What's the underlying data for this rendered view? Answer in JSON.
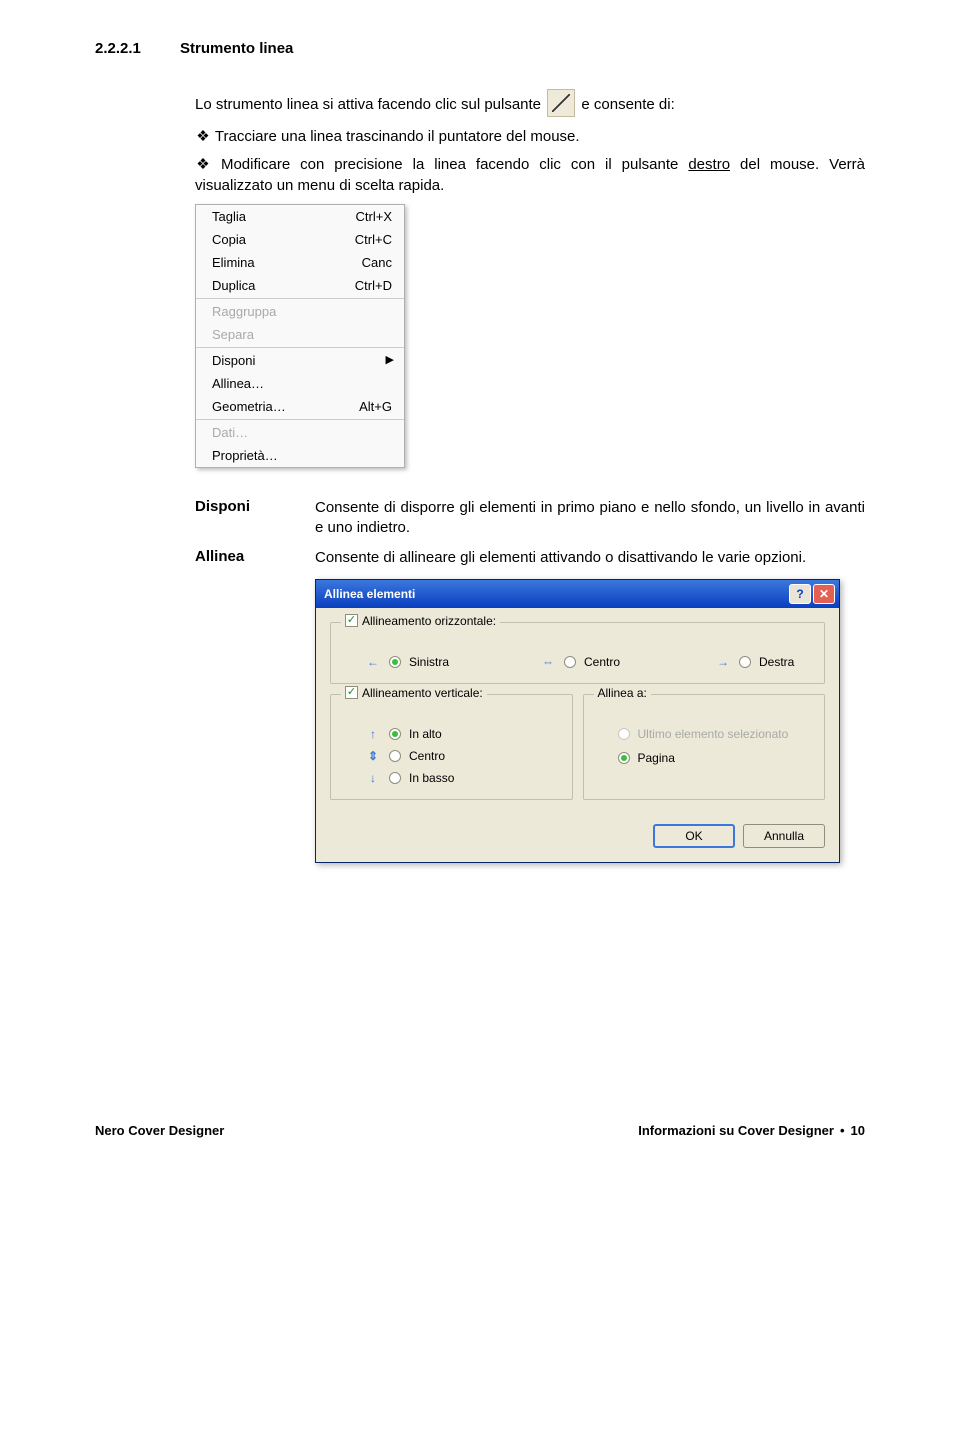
{
  "heading": {
    "number": "2.2.2.1",
    "title": "Strumento linea"
  },
  "intro": {
    "para1_a": "Lo strumento linea si attiva facendo clic sul pulsante",
    "para1_b": " e consente di:",
    "bullet1": "Tracciare una linea trascinando il puntatore del mouse.",
    "bullet2_a": "Modificare con precisione la linea facendo clic con il pulsante ",
    "bullet2_underline": "destro",
    "bullet2_b": " del mouse. Verrà visualizzato un menu di scelta rapida.",
    "bullet_char": "❖"
  },
  "ctx": {
    "rows": [
      {
        "label": "Taglia",
        "sc": "Ctrl+X",
        "enabled": true
      },
      {
        "label": "Copia",
        "sc": "Ctrl+C",
        "enabled": true
      },
      {
        "label": "Elimina",
        "sc": "Canc",
        "enabled": true
      },
      {
        "label": "Duplica",
        "sc": "Ctrl+D",
        "enabled": true
      },
      {
        "sep": true
      },
      {
        "label": "Raggruppa",
        "sc": "",
        "enabled": false
      },
      {
        "label": "Separa",
        "sc": "",
        "enabled": false
      },
      {
        "sep": true
      },
      {
        "label": "Disponi",
        "sc": "",
        "enabled": true,
        "submenu": true
      },
      {
        "label": "Allinea…",
        "sc": "",
        "enabled": true
      },
      {
        "label": "Geometria…",
        "sc": "Alt+G",
        "enabled": true
      },
      {
        "sep": true
      },
      {
        "label": "Dati…",
        "sc": "",
        "enabled": false
      },
      {
        "label": "Proprietà…",
        "sc": "",
        "enabled": true
      }
    ]
  },
  "defs": {
    "term1": "Disponi",
    "desc1": "Consente di disporre gli elementi in primo piano e nello sfondo, un livello in avanti e uno indietro.",
    "term2": "Allinea",
    "desc2": "Consente di allineare gli elementi attivando o disattivando le varie opzioni."
  },
  "dlg": {
    "title": "Allinea elementi",
    "horiz": {
      "label": "Allineamento orizzontale:",
      "sinistra": "Sinistra",
      "centro": "Centro",
      "destra": "Destra",
      "left_arrow": "←",
      "center_arrow": "⇔",
      "right_arrow": "→"
    },
    "vert": {
      "label": "Allineamento verticale:",
      "alto": "In alto",
      "centro": "Centro",
      "basso": "In basso",
      "up_arrow": "↑",
      "mid_arrow": "⇕",
      "down_arrow": "↓"
    },
    "target": {
      "label": "Allinea a:",
      "ultimo": "Ultimo elemento selezionato",
      "pagina": "Pagina"
    },
    "ok": "OK",
    "cancel": "Annulla"
  },
  "footer": {
    "left": "Nero Cover Designer",
    "right_label": "Informazioni su Cover Designer",
    "bullet": "•",
    "page": "10"
  }
}
